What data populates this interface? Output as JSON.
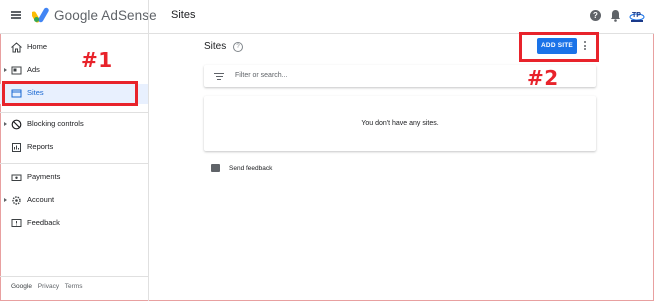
{
  "header": {
    "brand": "Google AdSense",
    "section_title": "Sites",
    "help_symbol": "?"
  },
  "sidebar": {
    "items": [
      {
        "label": "Home",
        "icon": "home-icon"
      },
      {
        "label": "Ads",
        "icon": "ads-icon"
      },
      {
        "label": "Sites",
        "icon": "sites-icon",
        "active": true
      },
      {
        "label": "Blocking controls",
        "icon": "block-icon"
      },
      {
        "label": "Reports",
        "icon": "reports-icon"
      },
      {
        "label": "Payments",
        "icon": "payments-icon"
      },
      {
        "label": "Account",
        "icon": "gear-icon"
      },
      {
        "label": "Feedback",
        "icon": "feedback-icon"
      }
    ],
    "footer": {
      "google": "Google",
      "privacy": "Privacy",
      "terms": "Terms"
    }
  },
  "main": {
    "title": "Sites",
    "help_symbol": "?",
    "add_site_label": "ADD SITE",
    "filter_placeholder": "Filter or search...",
    "empty_message": "You don't have any sites.",
    "send_feedback": "Send feedback"
  },
  "annotations": {
    "label_1": "#1",
    "label_2": "#2",
    "color": "#e8232b"
  },
  "colors": {
    "accent": "#1a73e8",
    "active_bg": "#e8f0fe",
    "highlight": "#e8232b"
  }
}
